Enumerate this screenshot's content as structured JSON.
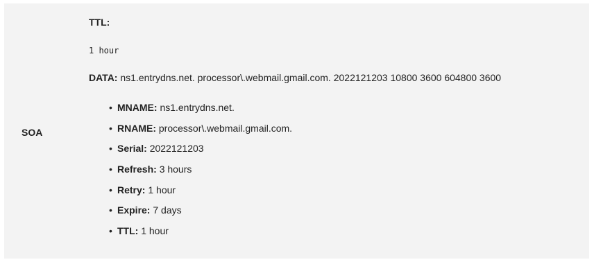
{
  "record": {
    "type": "SOA",
    "ttl_label": "TTL:",
    "ttl_value": "1 hour",
    "data_label": "DATA:",
    "data_value": "ns1.entrydns.net. processor\\.webmail.gmail.com. 2022121203 10800 3600 604800 3600",
    "fields": [
      {
        "label": "MNAME:",
        "value": "ns1.entrydns.net."
      },
      {
        "label": "RNAME:",
        "value": "processor\\.webmail.gmail.com."
      },
      {
        "label": "Serial:",
        "value": "2022121203"
      },
      {
        "label": "Refresh:",
        "value": "3 hours"
      },
      {
        "label": "Retry:",
        "value": "1 hour"
      },
      {
        "label": "Expire:",
        "value": "7 days"
      },
      {
        "label": "TTL:",
        "value": "1 hour"
      }
    ]
  }
}
